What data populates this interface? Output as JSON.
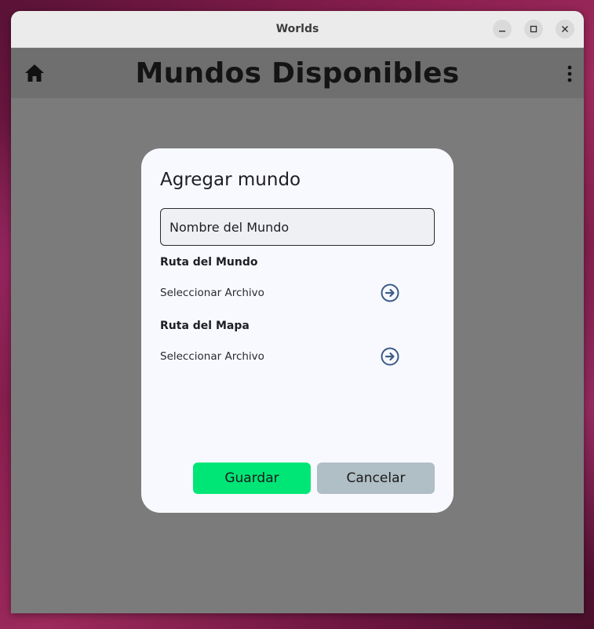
{
  "window": {
    "title": "Worlds"
  },
  "appbar": {
    "title": "Mundos Disponibles"
  },
  "dialog": {
    "title": "Agregar mundo",
    "world_name": {
      "placeholder": "Nombre del Mundo",
      "value": ""
    },
    "world_path": {
      "label": "Ruta del Mundo",
      "select_text": "Seleccionar Archivo"
    },
    "map_path": {
      "label": "Ruta del Mapa",
      "select_text": "Seleccionar Archivo"
    },
    "save_label": "Guardar",
    "cancel_label": "Cancelar"
  },
  "colors": {
    "save_button": "#00e676",
    "cancel_button": "#b0bec5",
    "arrow_icon": "#3b5b86",
    "dialog_bg": "#f8f9ff",
    "scrim": "#7b7b7b"
  },
  "icons": {
    "home": "home-icon",
    "menu": "more-vert-icon",
    "minimize": "minimize-icon",
    "maximize": "maximize-icon",
    "close": "close-icon",
    "select_world": "arrow-circle-right-icon",
    "select_map": "arrow-circle-right-icon"
  }
}
